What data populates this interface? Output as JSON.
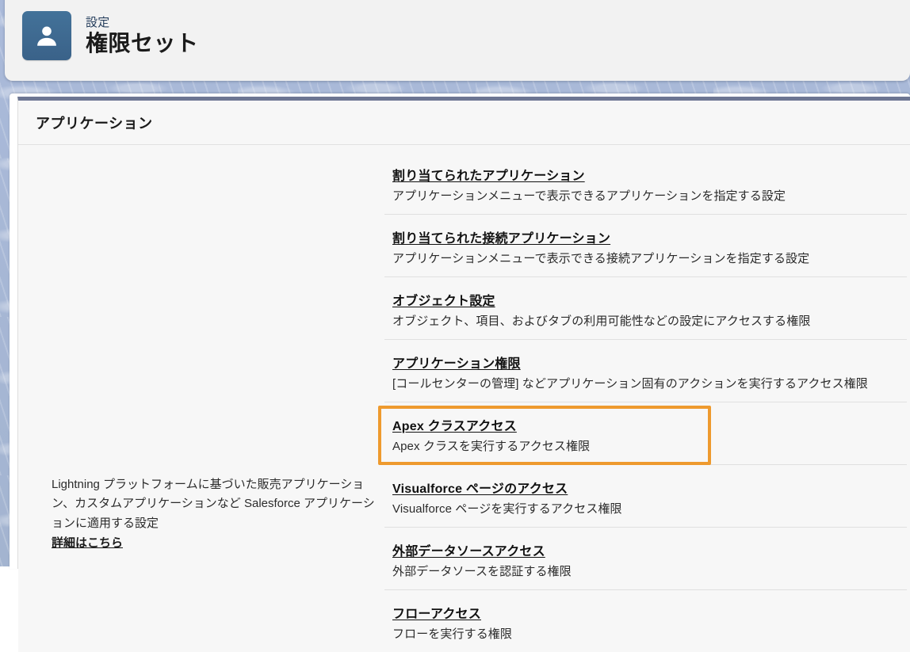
{
  "header": {
    "icon": "user-avatar-icon",
    "breadcrumb": "設定",
    "title": "権限セット"
  },
  "panel": {
    "title": "アプリケーション",
    "left_description": "Lightning プラットフォームに基づいた販売アプリケーション、カスタムアプリケーションなど Salesforce アプリケーションに適用する設定",
    "left_link": "詳細はこちら",
    "items": [
      {
        "label": "割り当てられたアプリケーション",
        "description": "アプリケーションメニューで表示できるアプリケーションを指定する設定"
      },
      {
        "label": "割り当てられた接続アプリケーション",
        "description": "アプリケーションメニューで表示できる接続アプリケーションを指定する設定"
      },
      {
        "label": "オブジェクト設定",
        "description": "オブジェクト、項目、およびタブの利用可能性などの設定にアクセスする権限"
      },
      {
        "label": "アプリケーション権限",
        "description": "[コールセンターの管理] などアプリケーション固有のアクションを実行するアクセス権限"
      },
      {
        "label": "Apex クラスアクセス",
        "description": "Apex クラスを実行するアクセス権限"
      },
      {
        "label": "Visualforce ページのアクセス",
        "description": "Visualforce ページを実行するアクセス権限"
      },
      {
        "label": "外部データソースアクセス",
        "description": "外部データソースを認証する権限"
      },
      {
        "label": "フローアクセス",
        "description": "フローを実行する権限"
      }
    ]
  },
  "highlight": {
    "target_label": "Visualforce ページのアクセス",
    "color": "#ee9a2e"
  },
  "colors": {
    "page_background": "#a3b4d0",
    "panel_background": "#f7f7f7",
    "panel_top_bar": "#6d7693",
    "icon_blue": "#3a6b9a",
    "breadcrumb_blue": "#28405e",
    "highlight_orange": "#ee9a2e"
  }
}
